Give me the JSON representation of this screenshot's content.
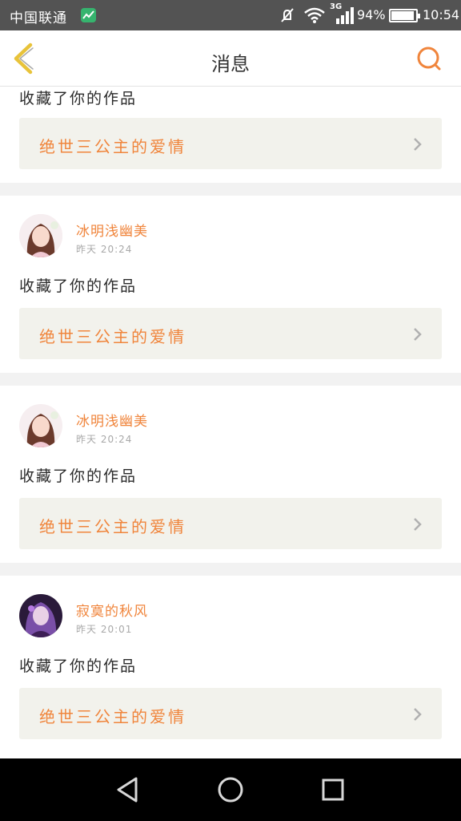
{
  "status_bar": {
    "carrier": "中国联通",
    "network": "3G",
    "battery": "94%",
    "battery_level": 0.94,
    "time": "10:54"
  },
  "header": {
    "title": "消息"
  },
  "messages": [
    {
      "action": "收藏了你的作品",
      "work_title": "绝世三公主的爱情"
    },
    {
      "user": "冰明浅幽美",
      "time": "昨天 20:24",
      "action": "收藏了你的作品",
      "work_title": "绝世三公主的爱情"
    },
    {
      "user": "冰明浅幽美",
      "time": "昨天 20:24",
      "action": "收藏了你的作品",
      "work_title": "绝世三公主的爱情"
    },
    {
      "user": "寂寞的秋风",
      "time": "昨天 20:01",
      "action": "收藏了你的作品",
      "work_title": "绝世三公主的爱情"
    }
  ],
  "colors": {
    "accent": "#f0853c",
    "back_arrow": "#e8c33a",
    "link_bg": "#f2f2ec"
  },
  "icons": {
    "back": "chevron-left-icon",
    "search": "search-icon",
    "chevron": "chevron-right-icon",
    "nav_back": "triangle-back-icon",
    "nav_home": "circle-home-icon",
    "nav_recent": "square-recent-icon"
  }
}
